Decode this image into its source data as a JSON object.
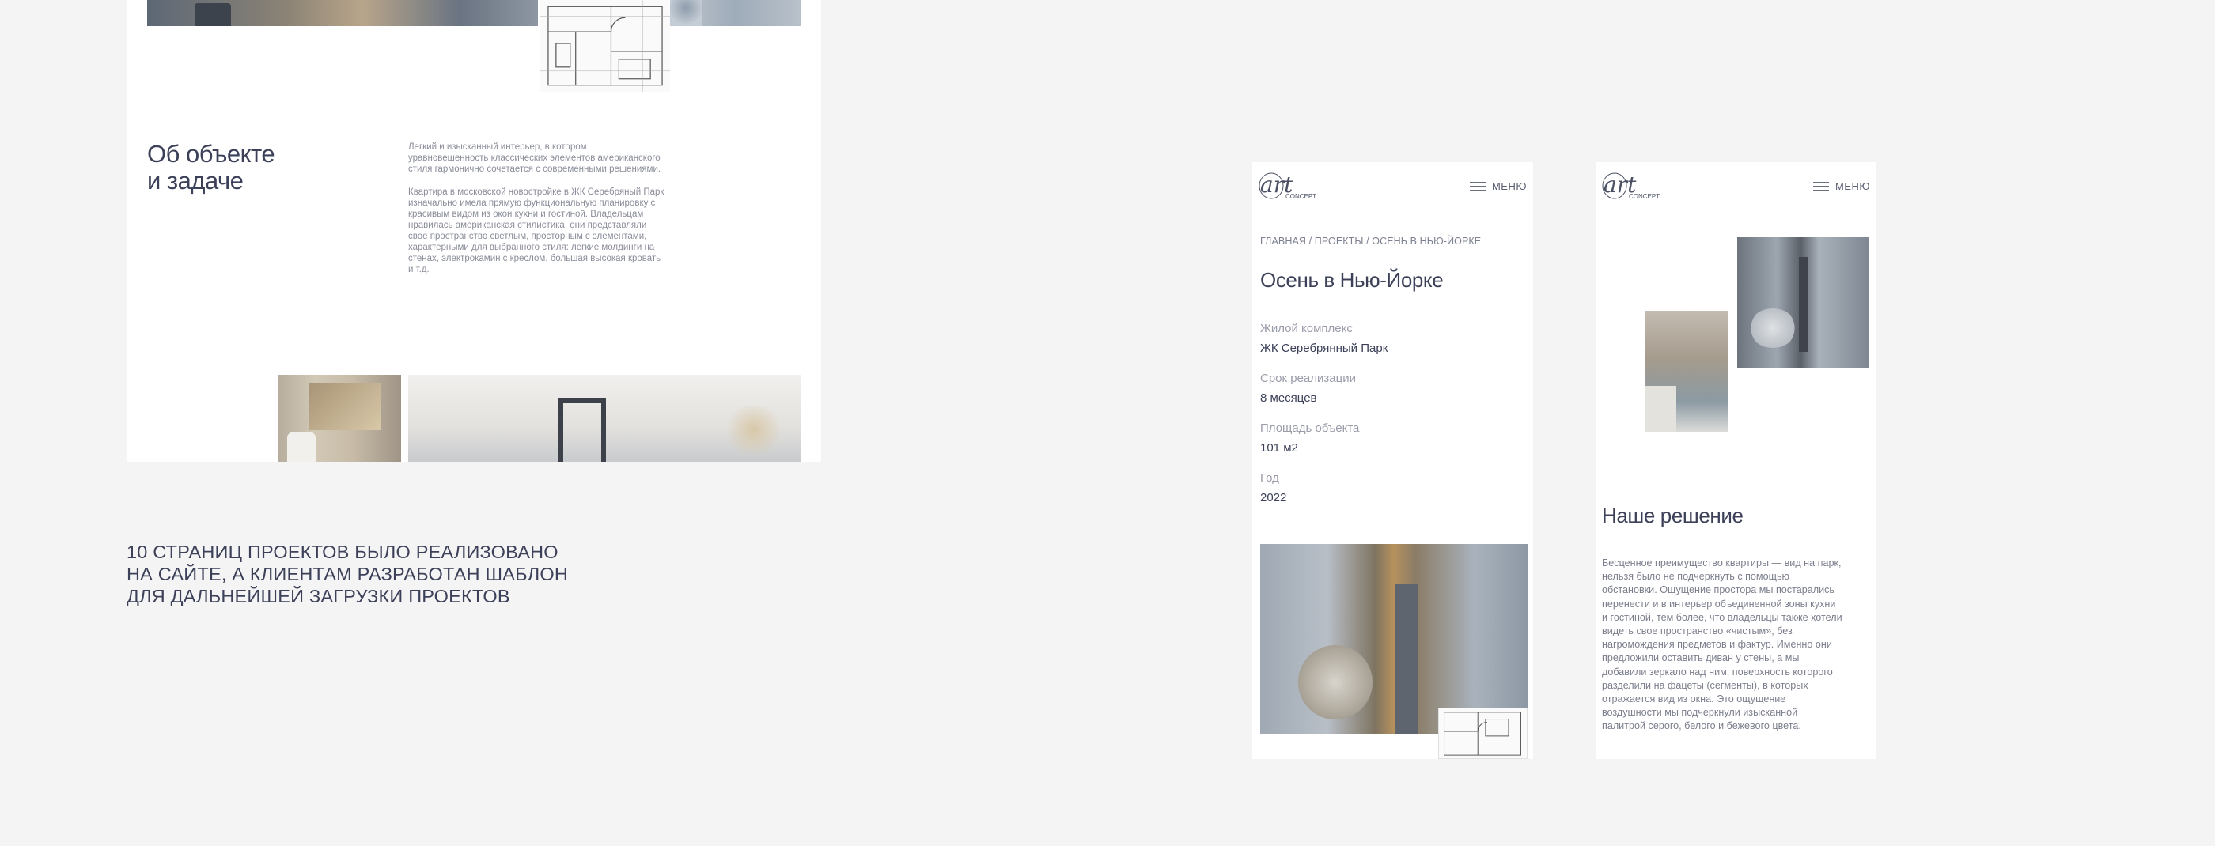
{
  "desktop": {
    "about": {
      "title_line1": "Об объекте",
      "title_line2": "и задаче",
      "paragraph1": "Легкий и изысканный интерьер, в котором уравновешенность классических элементов американского стиля гармонично сочетается с современными решениями.",
      "paragraph2": "Квартира в московской новостройке в ЖК Серебряный Парк изначально имела прямую функциональную планировку с красивым видом из окон кухни и гостиной. Владельцам нравилась американская стилистика, они представляли свое пространство светлым, просторным с элементами, характерными для выбранного стиля: легкие молдинги на стенах, электрокамин с креслом, большая высокая кровать и т.д."
    }
  },
  "caption": {
    "line1": "10 СТРАНИЦ ПРОЕКТОВ БЫЛО РЕАЛИЗОВАНО",
    "line2": "НА САЙТЕ, А КЛИЕНТАМ РАЗРАБОТАН ШАБЛОН",
    "line3": "ДЛЯ ДАЛЬНЕЙШЕЙ ЗАГРУЗКИ ПРОЕКТОВ"
  },
  "mobile": {
    "logo_text": "art CONCEPT",
    "menu_label": "МЕНЮ",
    "breadcrumb": "ГЛАВНАЯ / ПРОЕКТЫ / ОСЕНЬ В НЬЮ-ЙОРКЕ",
    "title": "Осень в Нью-Йорке",
    "specs": [
      {
        "label": "Жилой комплекс",
        "value": "ЖК Серебрянный Парк"
      },
      {
        "label": "Срок реализации",
        "value": "8 месяцев"
      },
      {
        "label": "Площадь объекта",
        "value": "101 м2"
      },
      {
        "label": "Год",
        "value": "2022"
      }
    ],
    "solution": {
      "title": "Наше решение",
      "text": "Бесценное преимущество квартиры — вид на парк, нельзя было не подчеркнуть с помощью обстановки. Ощущение простора мы постарались перенести и в интерьер объединенной зоны кухни и гостиной, тем более, что владельцы также хотели видеть свое пространство «чистым», без нагромождения предметов и фактур. Именно они предложили оставить диван у стены, а мы добавили зеркало над ним, поверхность которого разделили на фацеты (сегменты), в которых отражается вид из окна. Это ощущение воздушности мы подчеркнули изысканной палитрой серого, белого и бежевого цвета."
    }
  },
  "colors": {
    "background": "#f4f4f4",
    "heading": "#3c4159",
    "muted_text": "#8a8d99"
  }
}
